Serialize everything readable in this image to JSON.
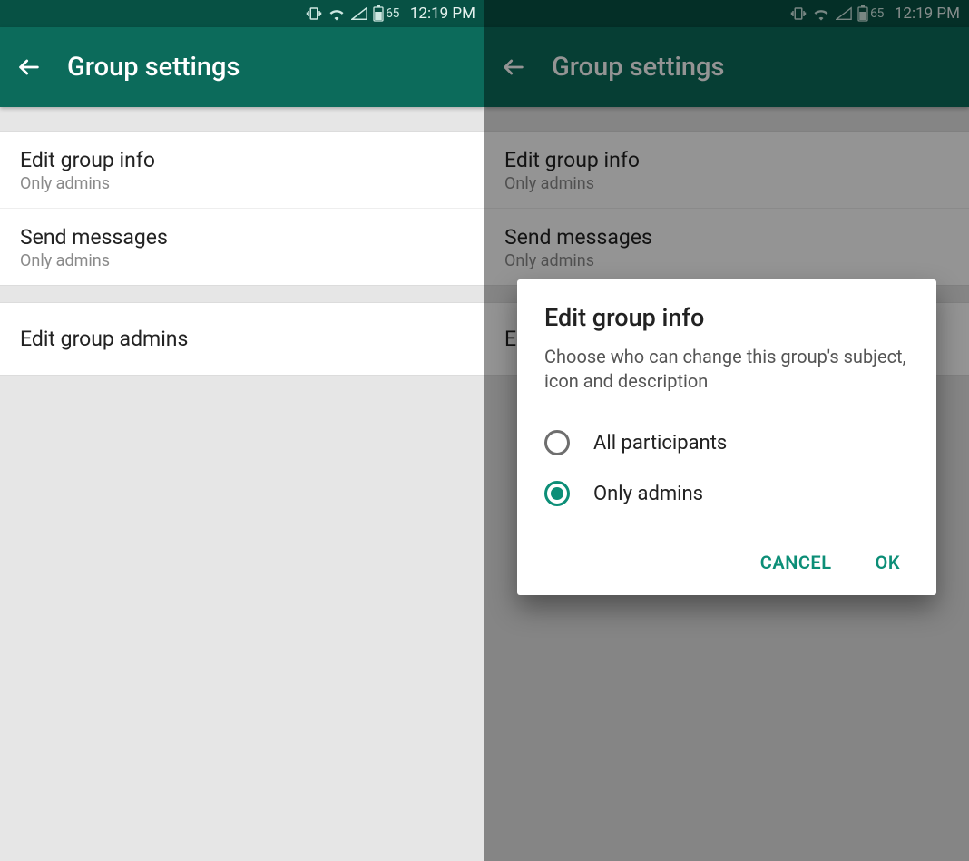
{
  "status": {
    "battery_pct": "65",
    "time": "12:19 PM"
  },
  "header": {
    "title": "Group settings"
  },
  "settings": {
    "edit_info": {
      "label": "Edit group info",
      "value": "Only admins"
    },
    "send_msg": {
      "label": "Send messages",
      "value": "Only admins"
    },
    "edit_admins": {
      "label": "Edit group admins"
    }
  },
  "dialog": {
    "title": "Edit group info",
    "description": "Choose who can change this group's subject, icon and description",
    "options": {
      "all": "All participants",
      "admins": "Only admins"
    },
    "cancel": "CANCEL",
    "ok": "OK"
  }
}
